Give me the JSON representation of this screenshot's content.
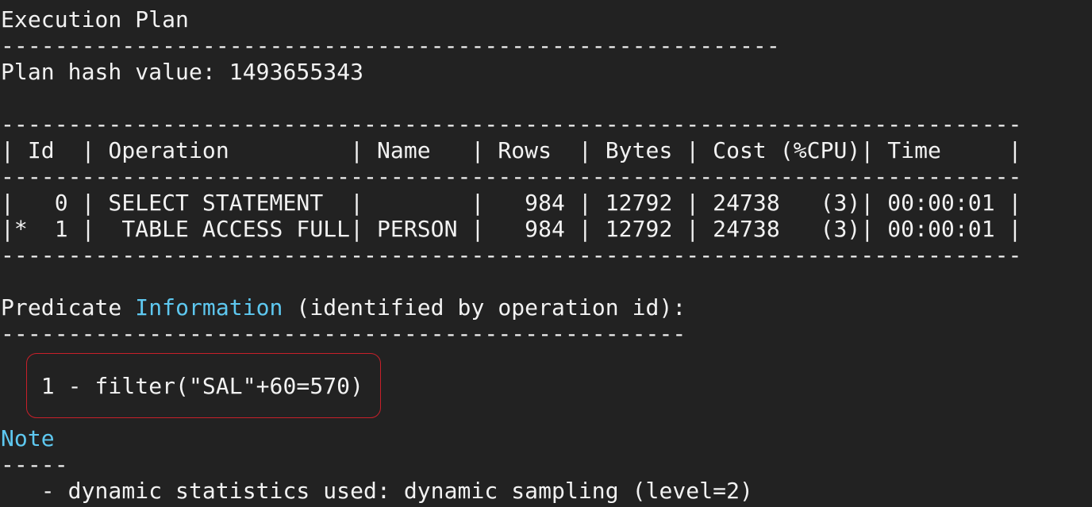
{
  "terminal": {
    "title": "Execution Plan",
    "title_rule": "----------------------------------------------------------",
    "plan_hash": {
      "label": "Plan hash value:",
      "value": "1493655343"
    },
    "table": {
      "rule_top": "----------------------------------------------------------------------------",
      "header_row": "| Id  | Operation         | Name   | Rows  | Bytes | Cost (%CPU)| Time     |",
      "rule_mid": "----------------------------------------------------------------------------",
      "rows": [
        "|   0 | SELECT STATEMENT  |        |   984 | 12792 | 24738   (3)| 00:00:01 |",
        "|*  1 |  TABLE ACCESS FULL| PERSON |   984 | 12792 | 24738   (3)| 00:00:01 |"
      ],
      "rule_bottom": "----------------------------------------------------------------------------"
    },
    "predicate": {
      "heading_prefix": "Predicate ",
      "heading_keyword": "Information",
      "heading_suffix": " (identified by operation id):",
      "rule": "---------------------------------------------------",
      "items": [
        "   1 - filter(\"SAL\"+60=570)"
      ]
    },
    "note": {
      "heading": "Note",
      "rule": "-----",
      "items": [
        "   - dynamic statistics used: dynamic sampling (level=2)"
      ]
    },
    "colors": {
      "background": "#222222",
      "text": "#f2f2f2",
      "keyword": "#5ec8f0",
      "highlight_border": "#c8202a"
    }
  }
}
